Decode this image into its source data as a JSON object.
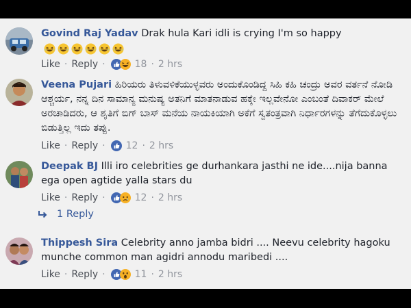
{
  "comments": [
    {
      "author": "Govind Raj Yadav",
      "text": "Drak hula Kari idli is crying I'm so happy",
      "emoji_count": 6,
      "reactions": [
        "like-icon",
        "haha-icon"
      ],
      "like_label": "Like",
      "reply_label": "Reply",
      "reaction_count": "18",
      "time": "2 hrs"
    },
    {
      "author": "Veena Pujari",
      "text": "ಹಿರಿಯರು ತಿಳುವಳಿಕೆಯುಳ್ಳವರು ಅಂದುಕೊಂಡಿದ್ದ ಸಿಹಿ ಕಹಿ ಚಂದ್ರು ಅವರ ವರ್ತನೆ ನೋಡಿ ಆಶ್ಚರ್ಯ, ನನ್ನ ದಿನ ಸಾಮಾನ್ಯ ಮನುಷ್ಯ ಅತನಿಗೆ ಮಾತನಾಡುವ ಹಕ್ಕೇ ಇಲ್ಲವೇನೋ ಎಂಬಂತೆ ದಿವಾಕರ್ ಮೇಲೆ ಅರಚಾಡಿದರು, ಆ ಶೃತಿಗೆ ಬಿಗ್ ಬಾಸ್ ಮನೆಯ ನಾಯಕಿಯಾಗಿ ಅಕೆಗೆ ಸ್ವತಂತ್ರವಾಗಿ ನಿರ್ಧಾರಗಳನ್ನು ತೆಗೆದುಕೊಳ್ಳಲು ಬಿಡುತ್ತಿಲ್ಲ ಇದು ತಪ್ಪು.",
      "reactions": [
        "like-icon"
      ],
      "like_label": "Like",
      "reply_label": "Reply",
      "reaction_count": "12",
      "time": "2 hrs"
    },
    {
      "author": "Deepak BJ",
      "text": "Illi iro celebrities ge durhankara jasthi ne ide....nija banna ega open agtide yalla stars du",
      "reactions": [
        "like-icon",
        "sad-icon"
      ],
      "like_label": "Like",
      "reply_label": "Reply",
      "reaction_count": "12",
      "time": "2 hrs"
    },
    {
      "author": "Thippesh Sira",
      "text": "Celebrity anno jamba bidri .... Neevu celebrity hagoku munche common man agidri annodu maribedi ....",
      "reactions": [
        "like-icon",
        "wow-icon"
      ],
      "like_label": "Like",
      "reply_label": "Reply",
      "reaction_count": "11",
      "time": "2 hrs"
    }
  ],
  "replies_link": "1 Reply",
  "colors": {
    "name": "#365899",
    "background": "#f1f1f1",
    "like_blue": "#4267b2",
    "reaction_yellow": "#f7b125"
  }
}
